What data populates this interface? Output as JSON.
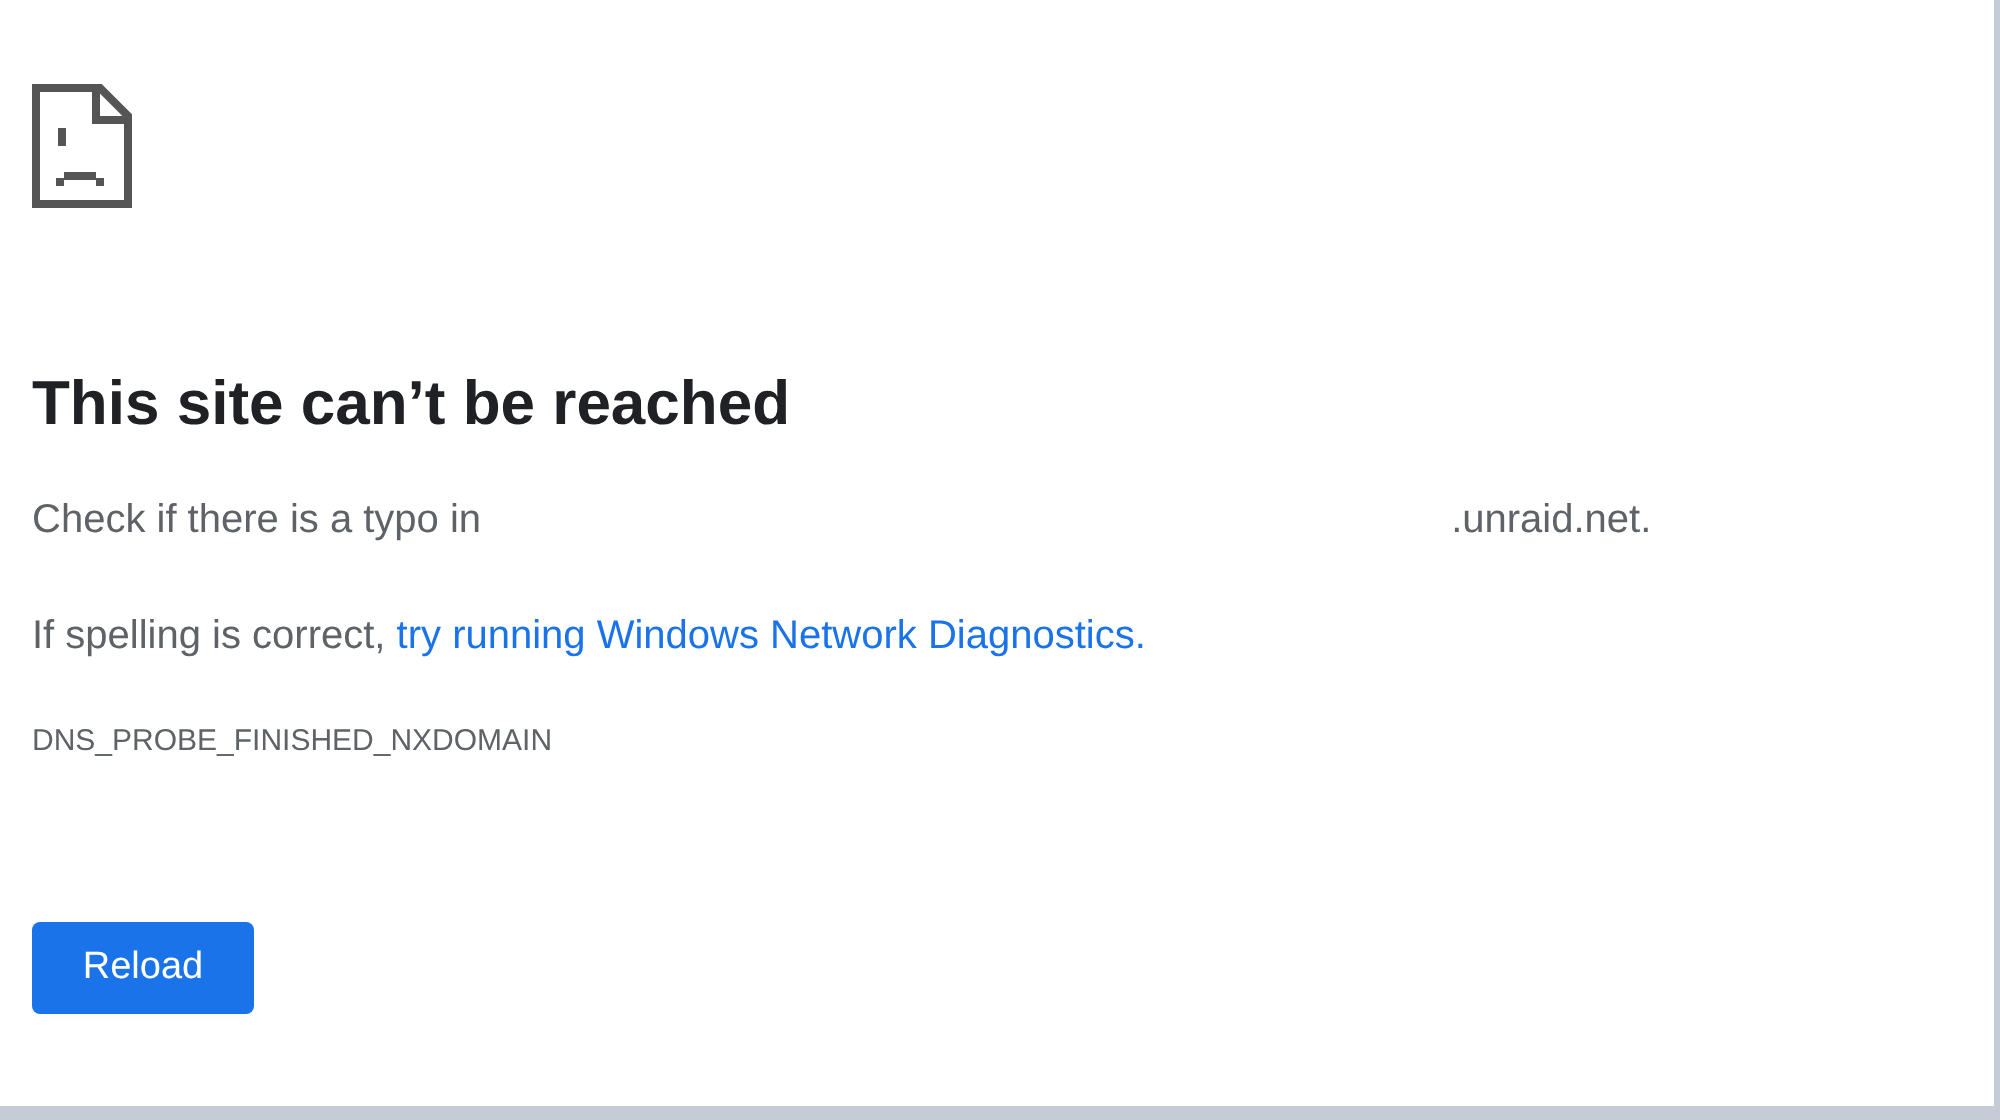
{
  "error_page": {
    "heading": "This site can’t be reached",
    "typo_hint": {
      "text": "Check if there is a typo in",
      "domain_suffix": ".unraid.net."
    },
    "suggestion": {
      "text": "If spelling is correct,",
      "link": "try running Windows Network Diagnostics."
    },
    "error_code": "DNS_PROBE_FINISHED_NXDOMAIN",
    "buttons": [
      {
        "label": "Reload"
      }
    ]
  }
}
